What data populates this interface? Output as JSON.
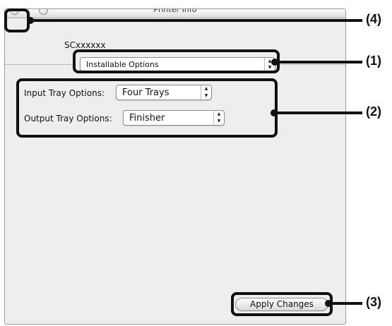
{
  "window": {
    "title": "Printer Info",
    "printer_name": "SCxxxxxx"
  },
  "panel_selector": {
    "value": "Installable Options"
  },
  "options": {
    "input_tray": {
      "label": "Input Tray Options:",
      "value": "Four Trays"
    },
    "output_tray": {
      "label": "Output Tray Options:",
      "value": "Finisher"
    }
  },
  "buttons": {
    "apply_label": "Apply Changes"
  },
  "callouts": {
    "c1": "(1)",
    "c2": "(2)",
    "c3": "(3)",
    "c4": "(4)"
  },
  "icons": {
    "close": "close-button-icon",
    "minimize": "minimize-button-icon",
    "popup_arrows": "up-down-arrows-icon"
  }
}
